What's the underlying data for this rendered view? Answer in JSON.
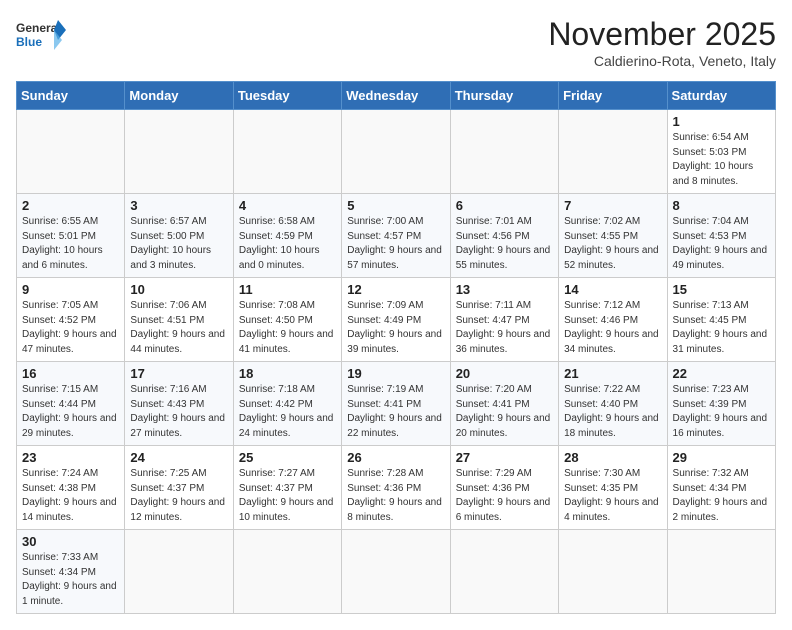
{
  "header": {
    "logo_general": "General",
    "logo_blue": "Blue",
    "month_year": "November 2025",
    "location": "Caldierino-Rota, Veneto, Italy"
  },
  "weekdays": [
    "Sunday",
    "Monday",
    "Tuesday",
    "Wednesday",
    "Thursday",
    "Friday",
    "Saturday"
  ],
  "weeks": [
    [
      {
        "day": "",
        "info": ""
      },
      {
        "day": "",
        "info": ""
      },
      {
        "day": "",
        "info": ""
      },
      {
        "day": "",
        "info": ""
      },
      {
        "day": "",
        "info": ""
      },
      {
        "day": "",
        "info": ""
      },
      {
        "day": "1",
        "info": "Sunrise: 6:54 AM\nSunset: 5:03 PM\nDaylight: 10 hours and 8 minutes."
      }
    ],
    [
      {
        "day": "2",
        "info": "Sunrise: 6:55 AM\nSunset: 5:01 PM\nDaylight: 10 hours and 6 minutes."
      },
      {
        "day": "3",
        "info": "Sunrise: 6:57 AM\nSunset: 5:00 PM\nDaylight: 10 hours and 3 minutes."
      },
      {
        "day": "4",
        "info": "Sunrise: 6:58 AM\nSunset: 4:59 PM\nDaylight: 10 hours and 0 minutes."
      },
      {
        "day": "5",
        "info": "Sunrise: 7:00 AM\nSunset: 4:57 PM\nDaylight: 9 hours and 57 minutes."
      },
      {
        "day": "6",
        "info": "Sunrise: 7:01 AM\nSunset: 4:56 PM\nDaylight: 9 hours and 55 minutes."
      },
      {
        "day": "7",
        "info": "Sunrise: 7:02 AM\nSunset: 4:55 PM\nDaylight: 9 hours and 52 minutes."
      },
      {
        "day": "8",
        "info": "Sunrise: 7:04 AM\nSunset: 4:53 PM\nDaylight: 9 hours and 49 minutes."
      }
    ],
    [
      {
        "day": "9",
        "info": "Sunrise: 7:05 AM\nSunset: 4:52 PM\nDaylight: 9 hours and 47 minutes."
      },
      {
        "day": "10",
        "info": "Sunrise: 7:06 AM\nSunset: 4:51 PM\nDaylight: 9 hours and 44 minutes."
      },
      {
        "day": "11",
        "info": "Sunrise: 7:08 AM\nSunset: 4:50 PM\nDaylight: 9 hours and 41 minutes."
      },
      {
        "day": "12",
        "info": "Sunrise: 7:09 AM\nSunset: 4:49 PM\nDaylight: 9 hours and 39 minutes."
      },
      {
        "day": "13",
        "info": "Sunrise: 7:11 AM\nSunset: 4:47 PM\nDaylight: 9 hours and 36 minutes."
      },
      {
        "day": "14",
        "info": "Sunrise: 7:12 AM\nSunset: 4:46 PM\nDaylight: 9 hours and 34 minutes."
      },
      {
        "day": "15",
        "info": "Sunrise: 7:13 AM\nSunset: 4:45 PM\nDaylight: 9 hours and 31 minutes."
      }
    ],
    [
      {
        "day": "16",
        "info": "Sunrise: 7:15 AM\nSunset: 4:44 PM\nDaylight: 9 hours and 29 minutes."
      },
      {
        "day": "17",
        "info": "Sunrise: 7:16 AM\nSunset: 4:43 PM\nDaylight: 9 hours and 27 minutes."
      },
      {
        "day": "18",
        "info": "Sunrise: 7:18 AM\nSunset: 4:42 PM\nDaylight: 9 hours and 24 minutes."
      },
      {
        "day": "19",
        "info": "Sunrise: 7:19 AM\nSunset: 4:41 PM\nDaylight: 9 hours and 22 minutes."
      },
      {
        "day": "20",
        "info": "Sunrise: 7:20 AM\nSunset: 4:41 PM\nDaylight: 9 hours and 20 minutes."
      },
      {
        "day": "21",
        "info": "Sunrise: 7:22 AM\nSunset: 4:40 PM\nDaylight: 9 hours and 18 minutes."
      },
      {
        "day": "22",
        "info": "Sunrise: 7:23 AM\nSunset: 4:39 PM\nDaylight: 9 hours and 16 minutes."
      }
    ],
    [
      {
        "day": "23",
        "info": "Sunrise: 7:24 AM\nSunset: 4:38 PM\nDaylight: 9 hours and 14 minutes."
      },
      {
        "day": "24",
        "info": "Sunrise: 7:25 AM\nSunset: 4:37 PM\nDaylight: 9 hours and 12 minutes."
      },
      {
        "day": "25",
        "info": "Sunrise: 7:27 AM\nSunset: 4:37 PM\nDaylight: 9 hours and 10 minutes."
      },
      {
        "day": "26",
        "info": "Sunrise: 7:28 AM\nSunset: 4:36 PM\nDaylight: 9 hours and 8 minutes."
      },
      {
        "day": "27",
        "info": "Sunrise: 7:29 AM\nSunset: 4:36 PM\nDaylight: 9 hours and 6 minutes."
      },
      {
        "day": "28",
        "info": "Sunrise: 7:30 AM\nSunset: 4:35 PM\nDaylight: 9 hours and 4 minutes."
      },
      {
        "day": "29",
        "info": "Sunrise: 7:32 AM\nSunset: 4:34 PM\nDaylight: 9 hours and 2 minutes."
      }
    ],
    [
      {
        "day": "30",
        "info": "Sunrise: 7:33 AM\nSunset: 4:34 PM\nDaylight: 9 hours and 1 minute."
      },
      {
        "day": "",
        "info": ""
      },
      {
        "day": "",
        "info": ""
      },
      {
        "day": "",
        "info": ""
      },
      {
        "day": "",
        "info": ""
      },
      {
        "day": "",
        "info": ""
      },
      {
        "day": "",
        "info": ""
      }
    ]
  ]
}
